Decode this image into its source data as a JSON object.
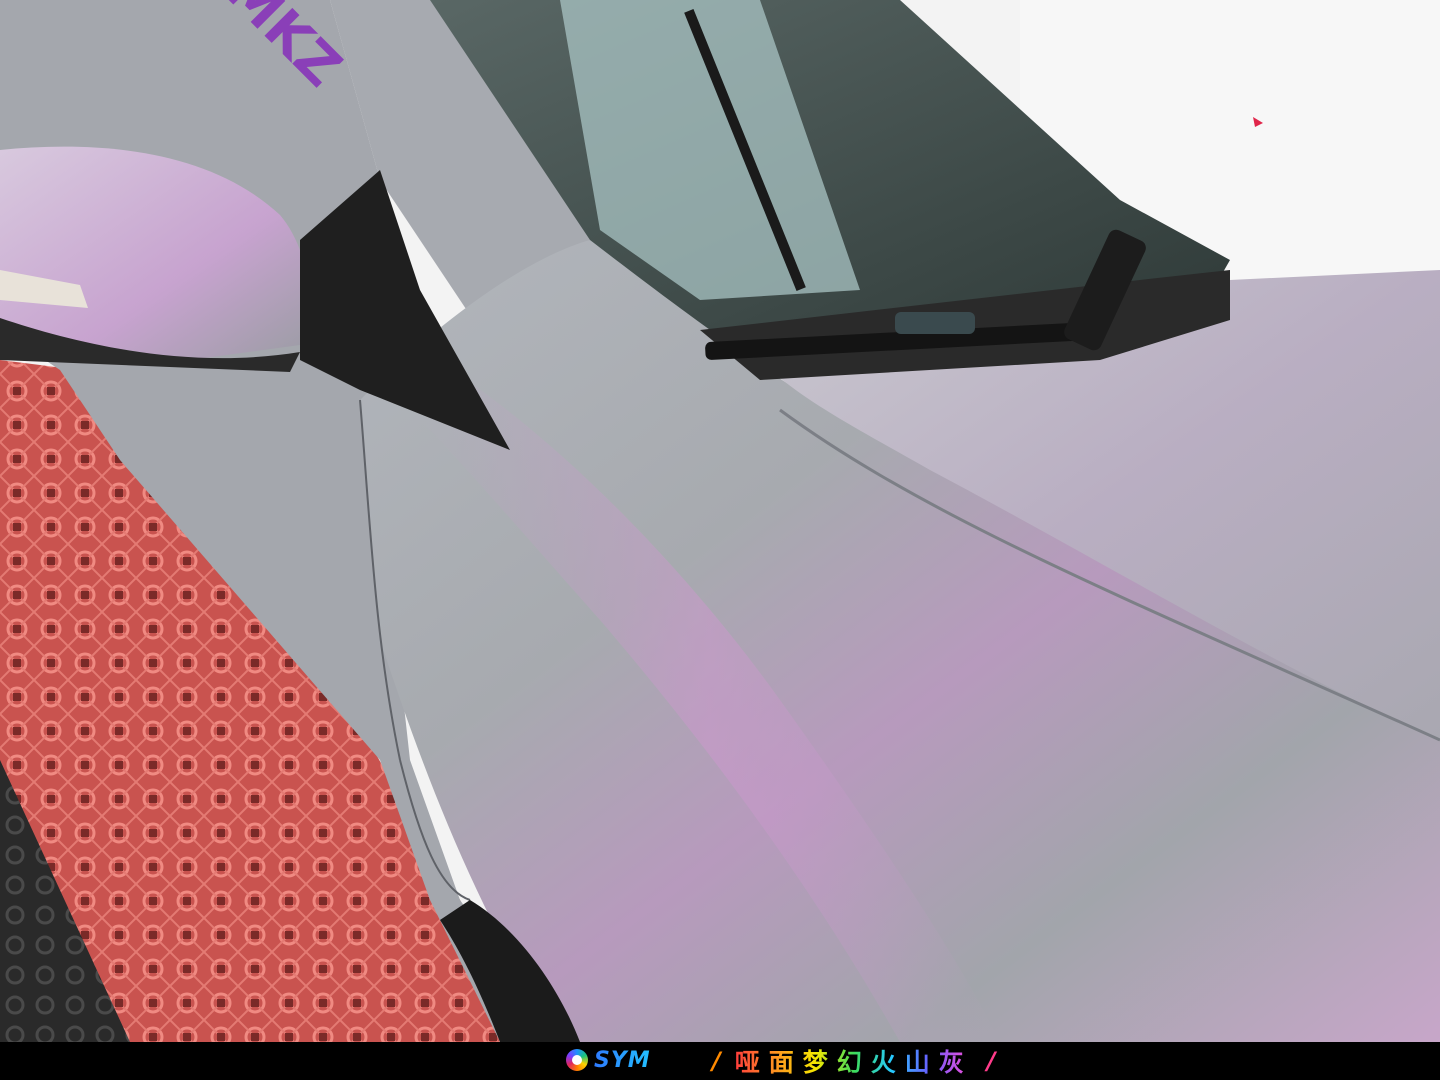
{
  "photo": {
    "subject": "car-front-fender-wrap",
    "colors": {
      "wrap_base": "#a3a8ad",
      "wrap_pink_sheen": "#c9a0cc",
      "wall": "#f3f3f3",
      "floor_grate": "#d86a64",
      "glass": "#3c4a48",
      "trim_black": "#1a1a1a"
    },
    "decal_text": "MKZ"
  },
  "caption": {
    "brand_logo_text": "SYM",
    "title": "哑面梦幻火山灰",
    "left_mark": "/",
    "right_mark": "/",
    "bar_color": "#000000"
  }
}
